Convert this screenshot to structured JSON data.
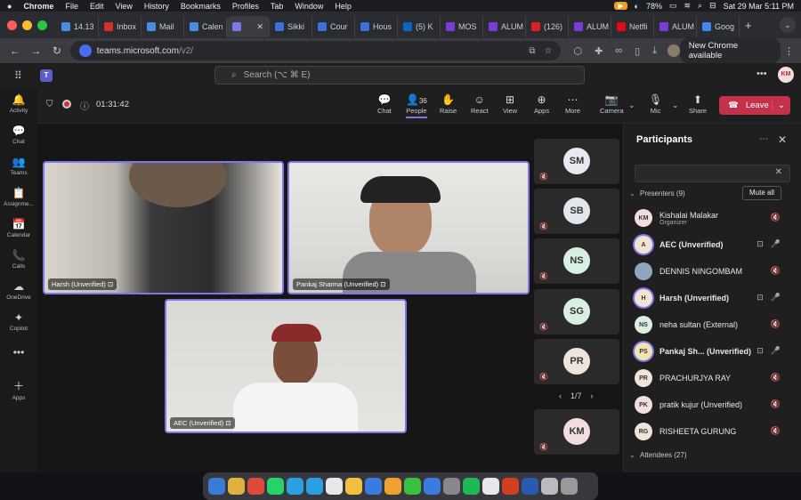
{
  "menubar": {
    "apple": "",
    "app_name": "Chrome",
    "menus": [
      "File",
      "Edit",
      "View",
      "History",
      "Bookmarks",
      "Profiles",
      "Tab",
      "Window",
      "Help"
    ],
    "battery": "78%",
    "datetime": "Sat 29 Mar  5:11 PM"
  },
  "tabs": [
    {
      "label": "14.13",
      "color": "#4a8de0"
    },
    {
      "label": "Inbox",
      "color": "#d93025"
    },
    {
      "label": "Mail",
      "color": "#4a8de0"
    },
    {
      "label": "Calen",
      "color": "#4a8de0"
    },
    {
      "label": "",
      "color": "#7b79e6",
      "active": true
    },
    {
      "label": "Sikki",
      "color": "#3b6fd9"
    },
    {
      "label": "Cour",
      "color": "#3b6fd9"
    },
    {
      "label": "Hous",
      "color": "#3b6fd9"
    },
    {
      "label": "(5) K",
      "color": "#0a66c2"
    },
    {
      "label": "MOS",
      "color": "#7a3bd9"
    },
    {
      "label": "ALUM",
      "color": "#7a3bd9"
    },
    {
      "label": "(126)",
      "color": "#e02020"
    },
    {
      "label": "ALUM",
      "color": "#7a3bd9"
    },
    {
      "label": "Netfli",
      "color": "#e50914"
    },
    {
      "label": "ALUM",
      "color": "#7a3bd9"
    },
    {
      "label": "Goog",
      "color": "#4285f4"
    }
  ],
  "address": {
    "host": "teams.microsoft.com",
    "path": "/v2/",
    "new_chrome": "New Chrome available"
  },
  "teams": {
    "search_placeholder": "Search (⌥ ⌘ E)",
    "user_initials": "KM"
  },
  "rail": [
    {
      "label": "Activity",
      "icon": "bell-icon",
      "glyph": "🔔"
    },
    {
      "label": "Chat",
      "icon": "chat-icon",
      "glyph": "💬"
    },
    {
      "label": "Teams",
      "icon": "teams-icon",
      "glyph": "👥"
    },
    {
      "label": "Assignme...",
      "icon": "assignments-icon",
      "glyph": "📋"
    },
    {
      "label": "Calendar",
      "icon": "calendar-icon",
      "glyph": "📅"
    },
    {
      "label": "Calls",
      "icon": "phone-icon",
      "glyph": "📞"
    },
    {
      "label": "OneDrive",
      "icon": "cloud-icon",
      "glyph": "☁"
    },
    {
      "label": "Copilot",
      "icon": "copilot-icon",
      "glyph": "✦"
    },
    {
      "label": "",
      "icon": "more-icon",
      "glyph": "•••"
    },
    {
      "label": "Apps",
      "icon": "apps-icon",
      "glyph": "＋"
    }
  ],
  "meeting": {
    "timer": "01:31:42",
    "people_count": "36",
    "controls": [
      "Chat",
      "People",
      "Raise",
      "React",
      "View",
      "Apps",
      "More",
      "Camera",
      "Mic",
      "Share"
    ],
    "leave": "Leave"
  },
  "videos": [
    {
      "name": "Harsh (Unverified)"
    },
    {
      "name": "Pankaj Sharma (Unverified)"
    },
    {
      "name": "AEC (Unverified)"
    }
  ],
  "strip": [
    {
      "initials": "SM",
      "color": "#e8e8f0"
    },
    {
      "initials": "SB",
      "color": "#e0e8ee"
    },
    {
      "initials": "NS",
      "color": "#d9efe2"
    },
    {
      "initials": "SG",
      "color": "#d9efe2"
    },
    {
      "initials": "PR",
      "color": "#efe4dc"
    },
    {
      "initials": "KM",
      "color": "#f2dede"
    }
  ],
  "pagination": "1/7",
  "panel": {
    "title": "Participants",
    "mute_all": "Mute all",
    "presenters_header": "Presenters (9)",
    "attendees_header": "Attendees (27)",
    "presenters": [
      {
        "initials": "KM",
        "name": "Kishalai Malakar",
        "sub": "Organizer",
        "color": "#f2dede",
        "bold": false,
        "ring": false,
        "mic": "off"
      },
      {
        "initials": "A",
        "name": "AEC (Unverified)",
        "sub": "",
        "color": "#f3e3d3",
        "bold": true,
        "ring": true,
        "mic": "on"
      },
      {
        "initials": "",
        "name": "DENNIS NINGOMBAM",
        "sub": "",
        "color": "#8fa6c0",
        "bold": false,
        "ring": false,
        "mic": "off"
      },
      {
        "initials": "H",
        "name": "Harsh (Unverified)",
        "sub": "",
        "color": "#f3e3d3",
        "bold": true,
        "ring": true,
        "mic": "on"
      },
      {
        "initials": "NS",
        "name": "neha sultan (External)",
        "sub": "",
        "color": "#d9efe2",
        "bold": false,
        "ring": false,
        "mic": "off"
      },
      {
        "initials": "PS",
        "name": "Pankaj Sh... (Unverified)",
        "sub": "",
        "color": "#f3e3b3",
        "bold": true,
        "ring": true,
        "mic": "on"
      },
      {
        "initials": "PR",
        "name": "PRACHURJYA RAY",
        "sub": "",
        "color": "#efe4dc",
        "bold": false,
        "ring": false,
        "mic": "off"
      },
      {
        "initials": "PK",
        "name": "pratik kujur (Unverified)",
        "sub": "",
        "color": "#f2dede",
        "bold": false,
        "ring": false,
        "mic": "off"
      },
      {
        "initials": "RG",
        "name": "RISHEETA GURUNG",
        "sub": "",
        "color": "#efe4dc",
        "bold": false,
        "ring": false,
        "mic": "off"
      }
    ]
  },
  "dock": [
    "#3a7bd5",
    "#e0b040",
    "#e04a3a",
    "#25d366",
    "#2aa0e0",
    "#2aa0e0",
    "#e8e8e8",
    "#f0c040",
    "#3a7be0",
    "#f0a030",
    "#3ac040",
    "#3a7be0",
    "#888888",
    "#1db954",
    "#e8e8e8",
    "#d04020",
    "#2a5ab0",
    "#bbbbbb",
    "#999999"
  ]
}
